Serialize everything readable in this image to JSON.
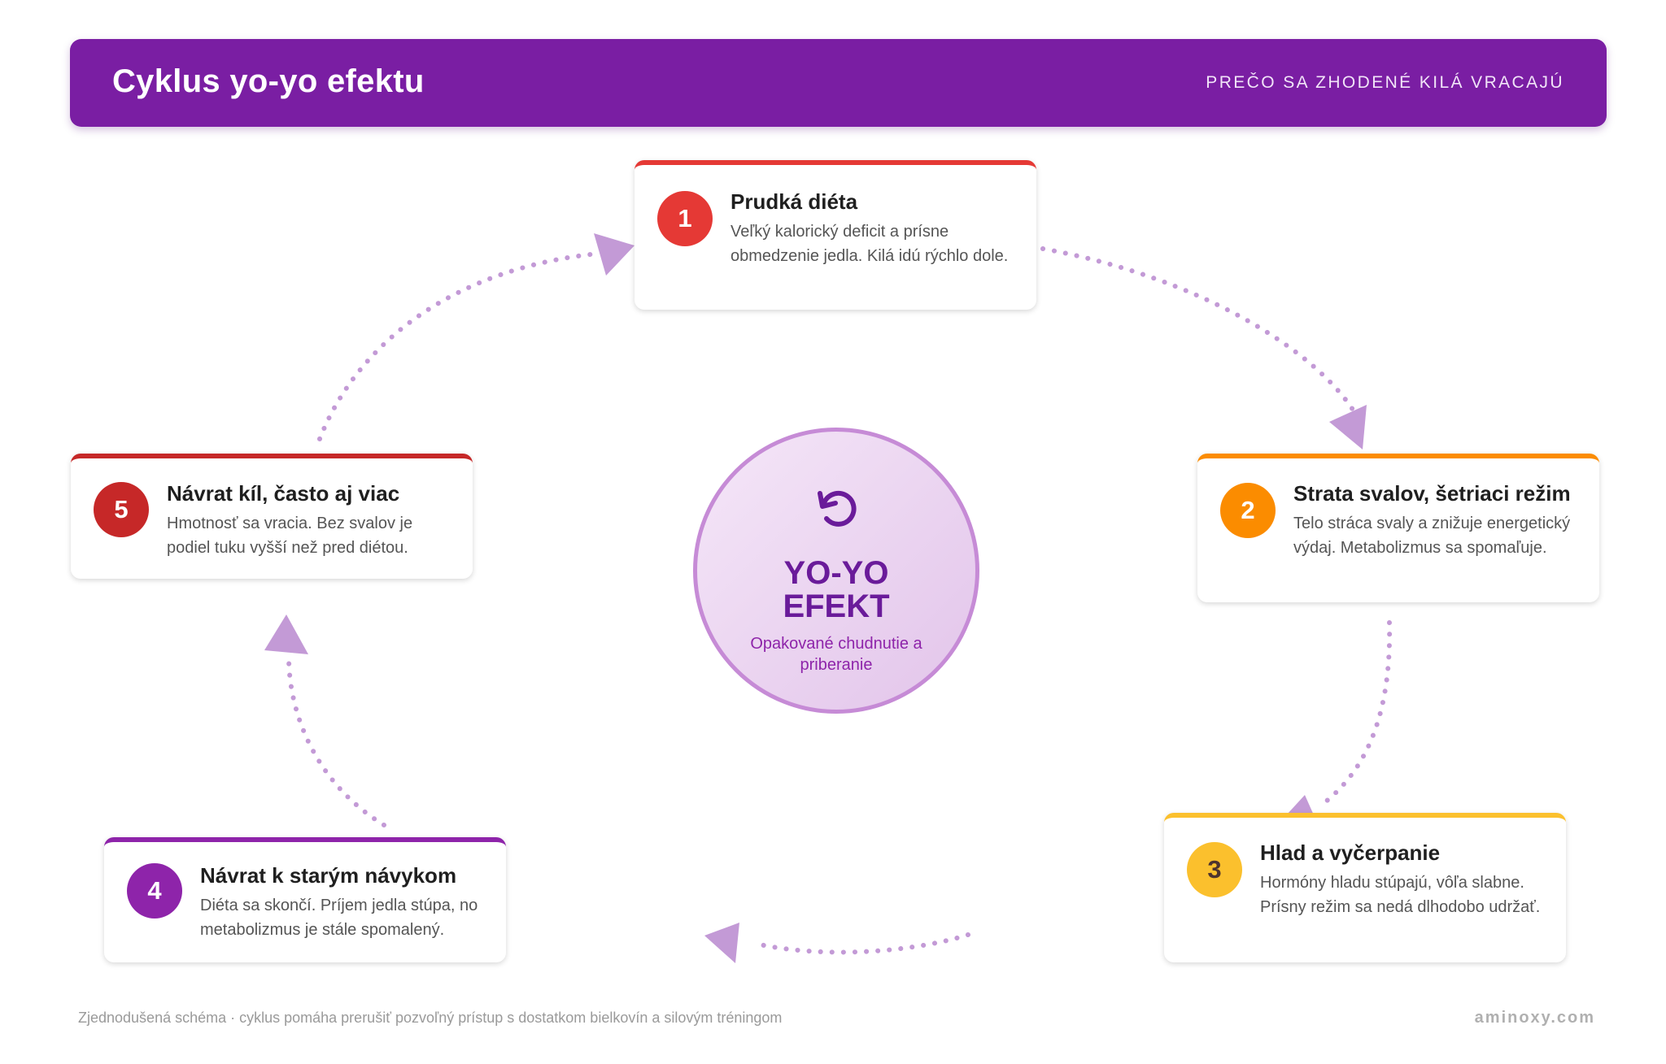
{
  "header": {
    "title": "Cyklus yo-yo efektu",
    "subtitle": "PREČO SA ZHODENÉ KILÁ VRACAJÚ"
  },
  "center": {
    "icon": "refresh-icon",
    "title_line1": "YO-YO",
    "title_line2": "EFEKT",
    "subtitle": "Opakované chudnutie a priberanie"
  },
  "steps": [
    {
      "number": "1",
      "title": "Prudká diéta",
      "description": "Veľký kalorický deficit a prísne obmedzenie jedla. Kilá idú rýchlo dole.",
      "color": "#e53935"
    },
    {
      "number": "2",
      "title": "Strata svalov, šetriaci režim",
      "description": "Telo stráca svaly a znižuje energetický výdaj. Metabolizmus sa spomaľuje.",
      "color": "#fb8c00"
    },
    {
      "number": "3",
      "title": "Hlad a vyčerpanie",
      "description": "Hormóny hladu stúpajú, vôľa slabne. Prísny režim sa nedá dlhodobo udržať.",
      "color": "#fbc02d"
    },
    {
      "number": "4",
      "title": "Návrat k starým návykom",
      "description": "Diéta sa skončí. Príjem jedla stúpa, no metabolizmus je stále spomalený.",
      "color": "#8e24aa"
    },
    {
      "number": "5",
      "title": "Návrat kíl, často aj viac",
      "description": "Hmotnosť sa vracia. Bez svalov je podiel tuku vyšší než pred diétou.",
      "color": "#c62828"
    }
  ],
  "colors": {
    "header": "#7a1ea3",
    "arrow": "#c39ad6",
    "hub_text": "#6a1b9a"
  },
  "footer": {
    "note": "Zjednodušená schéma · cyklus pomáha prerušiť pozvoľný prístup s dostatkom bielkovín a silovým tréningom",
    "brand": "aminoxy.com"
  }
}
